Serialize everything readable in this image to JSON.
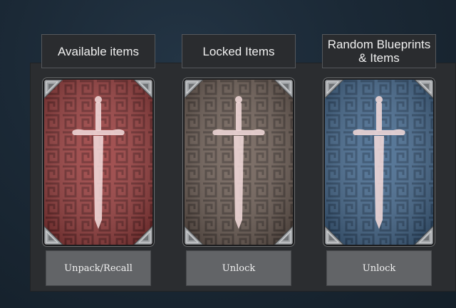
{
  "columns": [
    {
      "title": "Available items",
      "button_label": "Unpack/Recall",
      "card_color": "#9b3d3d",
      "card_dark": "#6e2627"
    },
    {
      "title": "Locked Items",
      "button_label": "Unlock",
      "card_color": "#6f5f56",
      "card_dark": "#4c403a"
    },
    {
      "title": "Random Blueprints\n& Items",
      "button_label": "Unlock",
      "card_color": "#44698f",
      "card_dark": "#2c4a6a"
    }
  ],
  "icons": {
    "card_emblem": "sword-icon",
    "card_corner": "metal-corner-icon"
  }
}
